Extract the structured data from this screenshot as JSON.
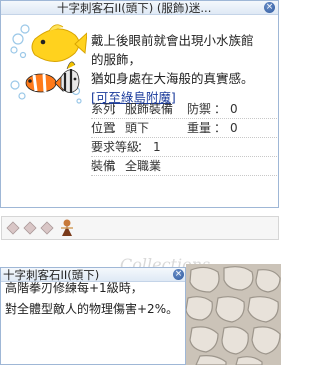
{
  "item_window": {
    "title": "十字刺客石II(頭下) (服飾)迷...",
    "close_label": "×",
    "description_lines": [
      "戴上後眼前就會出現小水族館",
      "的服飾，",
      "猶如身處在大海般的真實感。"
    ],
    "link_text": "[可至綠島附魔]",
    "stats": {
      "category_label": "系列",
      "category_value": "服飾裝備",
      "defense_label": "防禦",
      "defense_value": "0",
      "position_label": "位置",
      "position_value": "頭下",
      "weight_label": "重量",
      "weight_value": "0",
      "level_label": "要求等級",
      "level_value": "1",
      "equip_label": "裝備",
      "equip_value": "全職業"
    }
  },
  "card_window": {
    "title": "十字刺客石II(頭下)",
    "close_label": "×",
    "description_lines": [
      "高階拳刃修練每+1級時，",
      "對全體型敵人的物理傷害+2%。"
    ]
  },
  "watermark_text": "Collections",
  "colors": {
    "accent_blue": "#2f5aa0",
    "border": "#9fb7d6",
    "link": "#1c3c9c"
  }
}
